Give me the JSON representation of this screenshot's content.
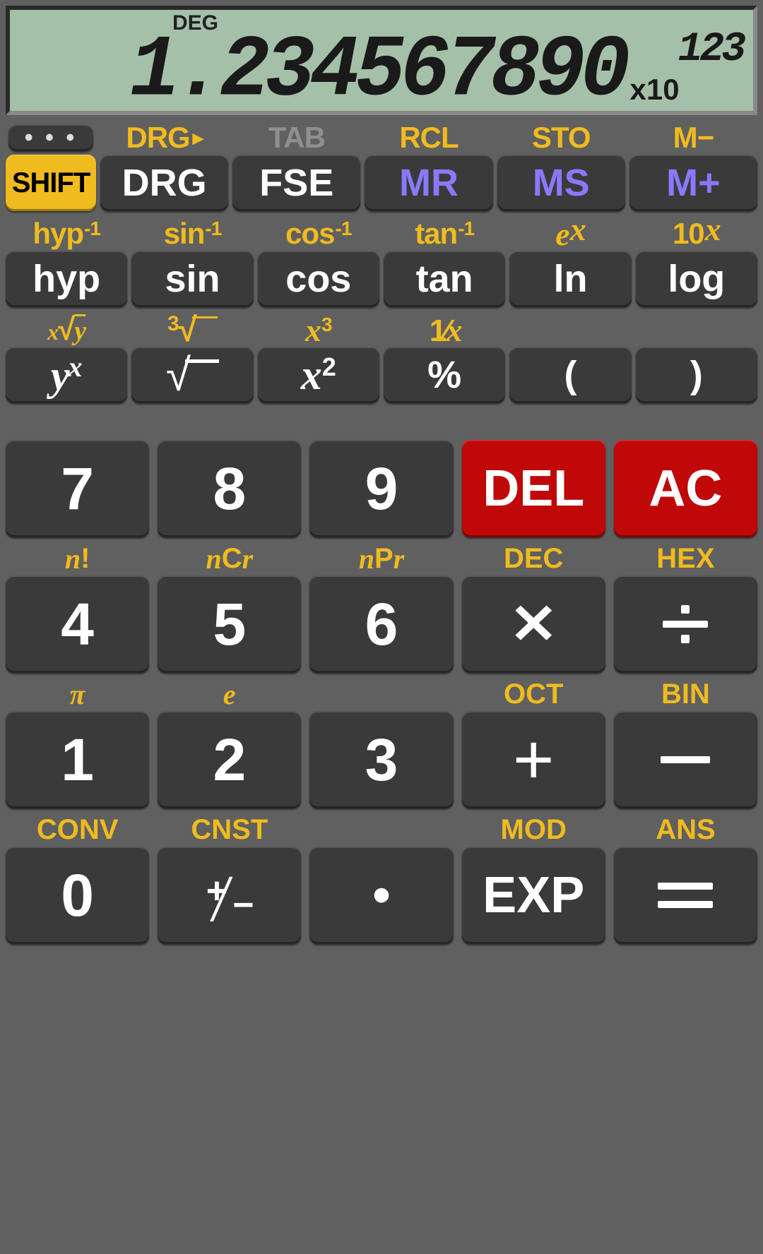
{
  "display": {
    "mode": "DEG",
    "value": "1.234567890",
    "exp_prefix": "x10",
    "exp_value": "123"
  },
  "menu_button": "• • •",
  "row1": {
    "shift_labels": [
      "DRG",
      "TAB",
      "RCL",
      "STO",
      "M−"
    ],
    "shift_dim_index": 1,
    "shift_button": "SHIFT",
    "buttons": [
      "DRG",
      "FSE",
      "MR",
      "MS",
      "M+"
    ],
    "purple_indexes": [
      2,
      3,
      4
    ]
  },
  "row2": {
    "shift_labels_html": [
      "hyp<sup>-1</sup>",
      "sin<sup>-1</sup>",
      "cos<sup>-1</sup>",
      "tan<sup>-1</sup>",
      "<span class='it'>e</span><sup class='it'>x</sup>",
      "10<sup class='it'>x</sup>"
    ],
    "buttons": [
      "hyp",
      "sin",
      "cos",
      "tan",
      "ln",
      "log"
    ]
  },
  "row3": {
    "shift_labels": [
      "x_root_y",
      "cube_root",
      "x_cubed",
      "one_over_x",
      "",
      ""
    ],
    "buttons": [
      "y_pow_x",
      "sqrt",
      "x_squared",
      "%",
      "(",
      ")"
    ]
  },
  "keypad": [
    {
      "shift": [
        "",
        "",
        "",
        "",
        ""
      ],
      "btn": [
        "7",
        "8",
        "9",
        "DEL",
        "AC"
      ],
      "red": [
        3,
        4
      ]
    },
    {
      "shift": [
        "n!",
        "nCr",
        "nPr",
        "DEC",
        "HEX"
      ],
      "btn": [
        "4",
        "5",
        "6",
        "mult",
        "div"
      ]
    },
    {
      "shift": [
        "π",
        "e",
        "",
        "OCT",
        "BIN"
      ],
      "btn": [
        "1",
        "2",
        "3",
        "plus",
        "minus"
      ]
    },
    {
      "shift": [
        "CONV",
        "CNST",
        "",
        "MOD",
        "ANS"
      ],
      "btn": [
        "0",
        "plusminus",
        "dot",
        "EXP",
        "eq"
      ]
    }
  ]
}
